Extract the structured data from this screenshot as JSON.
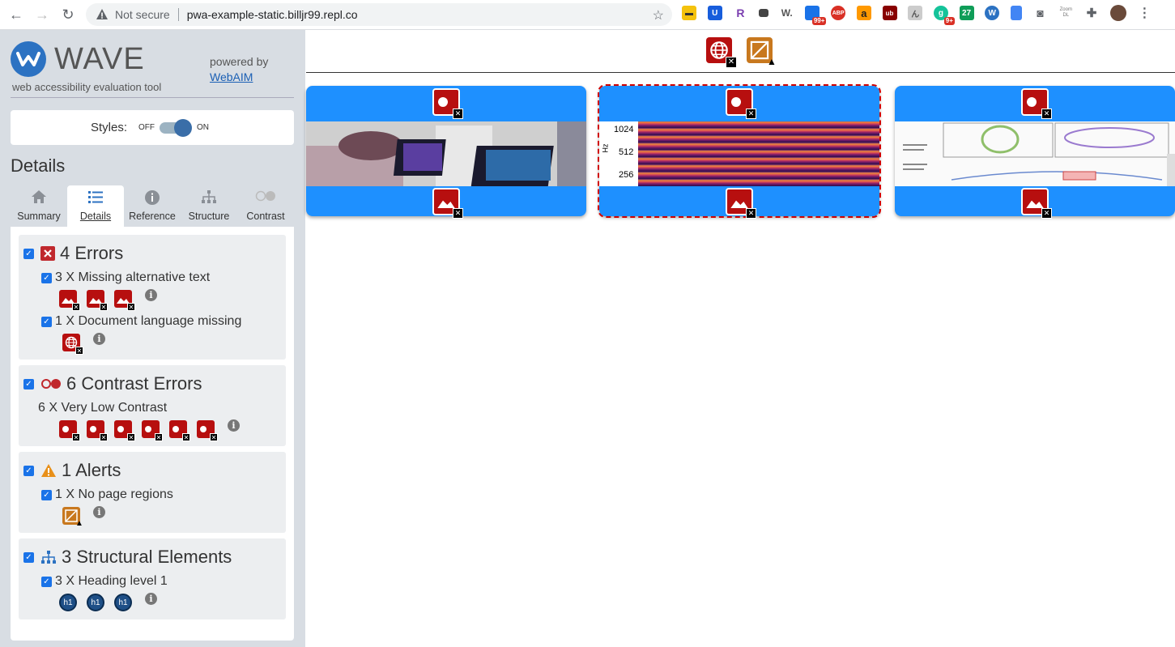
{
  "browser": {
    "not_secure": "Not secure",
    "url": "pwa-example-static.billjr99.repl.co",
    "ext_badges": [
      "99+",
      "9+",
      "27"
    ],
    "ext_texts": [
      "R",
      "W.",
      "ABP",
      "a",
      "ub",
      "Zoom DL"
    ]
  },
  "sidebar": {
    "logo_text": "WAVE",
    "logo_sub": "web accessibility evaluation tool",
    "powered_by": "powered by",
    "webaim": "WebAIM",
    "styles_label": "Styles:",
    "toggle_off": "OFF",
    "toggle_on": "ON",
    "details_title": "Details",
    "tabs": [
      {
        "label": "Summary",
        "icon": "home-icon",
        "active": false
      },
      {
        "label": "Details",
        "icon": "list-icon",
        "active": true
      },
      {
        "label": "Reference",
        "icon": "info-icon",
        "active": false
      },
      {
        "label": "Structure",
        "icon": "sitemap-icon",
        "active": false
      },
      {
        "label": "Contrast",
        "icon": "contrast-icon",
        "active": false
      }
    ],
    "groups": {
      "errors": {
        "title": "4 Errors",
        "items": [
          {
            "label": "3 X Missing alternative text",
            "count": 3
          },
          {
            "label": "1 X Document language missing",
            "count": 1
          }
        ]
      },
      "contrast": {
        "title": "6 Contrast Errors",
        "items": [
          {
            "label": "6 X Very Low Contrast",
            "count": 6
          }
        ]
      },
      "alerts": {
        "title": "1 Alerts",
        "items": [
          {
            "label": "1 X No page regions",
            "count": 1
          }
        ]
      },
      "structure": {
        "title": "3 Structural Elements",
        "items": [
          {
            "label": "3 X Heading level 1",
            "count": 3,
            "badge": "h1"
          }
        ]
      }
    }
  },
  "main": {
    "cards": 3,
    "spectrogram_labels": [
      "1024",
      "512",
      "256"
    ],
    "spectrogram_axis": "Hz"
  },
  "colors": {
    "error_red": "#b70f0f",
    "card_blue": "#1e90ff",
    "sidebar_bg": "#d8dde3",
    "accent": "#2c72c2"
  }
}
